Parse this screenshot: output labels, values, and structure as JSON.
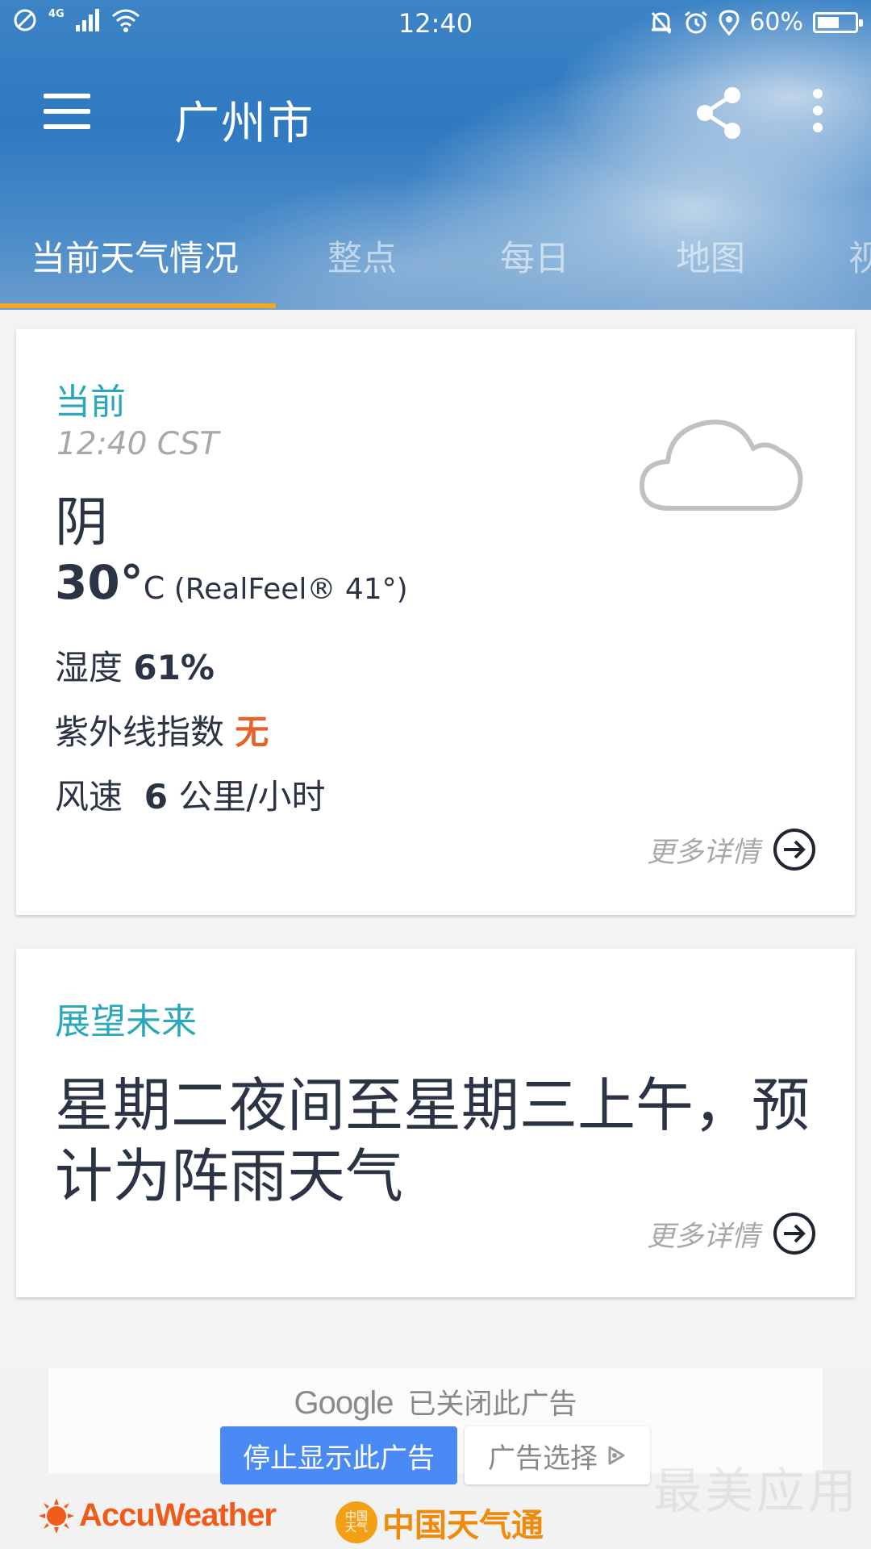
{
  "status_bar": {
    "network": "4G",
    "time": "12:40",
    "battery_text": "60%",
    "battery_level": 0.6
  },
  "header": {
    "city": "广州市",
    "tabs": [
      {
        "label": "当前天气情况",
        "active": true
      },
      {
        "label": "整点",
        "active": false
      },
      {
        "label": "每日",
        "active": false
      },
      {
        "label": "地图",
        "active": false
      },
      {
        "label": "视",
        "active": false
      }
    ]
  },
  "current": {
    "title": "当前",
    "time": "12:40 CST",
    "condition": "阴",
    "temp_value": "30°",
    "temp_unit": "C",
    "realfeel": "(RealFeel® 41°)",
    "humidity_label": "湿度",
    "humidity_value": "61%",
    "uv_label": "紫外线指数",
    "uv_value": "无",
    "wind_label": "风速",
    "wind_value": "6",
    "wind_unit": "公里/小时",
    "more_label": "更多详情",
    "icon": "cloud-icon"
  },
  "outlook": {
    "title": "展望未来",
    "text": "星期二夜间至星期三上午，预计为阵雨天气",
    "more_label": "更多详情"
  },
  "ad": {
    "google": "Google",
    "closed_text": "已关闭此广告",
    "stop_label": "停止显示此广告",
    "choice_label": "广告选择"
  },
  "footer": {
    "accuweather": "AccuWeather",
    "partner": "中国天气通",
    "seal_text": "中国天气"
  },
  "colors": {
    "accent": "#f5a623",
    "teal": "#2aa7b8",
    "uv": "#e5632a",
    "ad_button": "#4a8af4"
  }
}
